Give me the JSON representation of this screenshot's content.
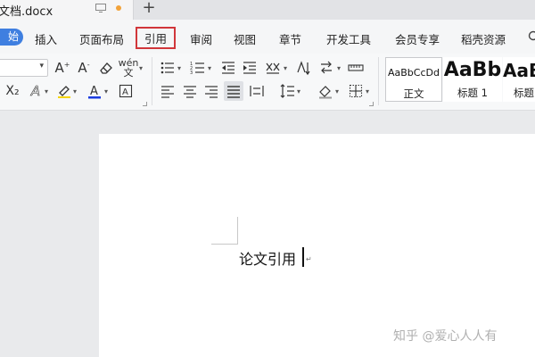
{
  "window": {
    "tab_title": "文档.docx",
    "new_tab_glyph": "+"
  },
  "menu": {
    "start": "始",
    "items": [
      "插入",
      "页面布局",
      "引用",
      "审阅",
      "视图",
      "章节",
      "开发工具",
      "会员专享",
      "稻壳资源"
    ],
    "active": "引用"
  },
  "toolbar": {
    "font_size_value": "",
    "subscript": "X₂",
    "styles": [
      {
        "sample": "AaBbCcDd",
        "label": "正文"
      },
      {
        "sample": "AaBb",
        "label": "标题 1"
      },
      {
        "sample": "AaB",
        "label": "标题"
      }
    ],
    "colors": {
      "accent": "#3f7fe0",
      "font_color_bar": "#1a3ce0",
      "active_border": "#d1363a"
    }
  },
  "document": {
    "body_text": "论文引用",
    "para_mark": "↵"
  },
  "watermark": "知乎 @爱心人人有"
}
